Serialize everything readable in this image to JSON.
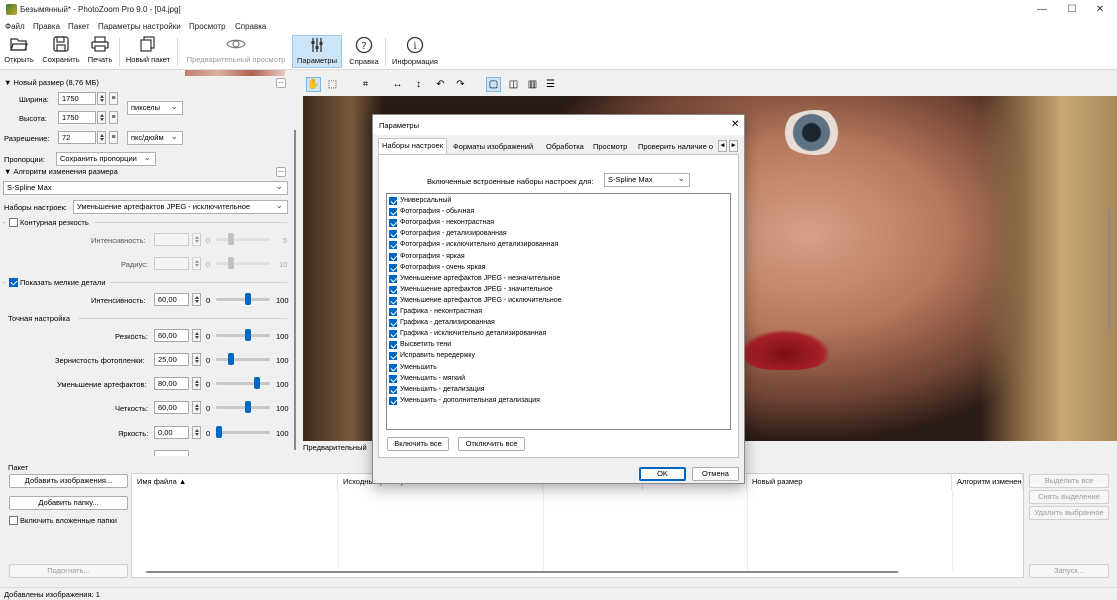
{
  "window": {
    "title": "Безымянный* - PhotoZoom Pro 9.0 - [04.jpg]",
    "minimize": "—",
    "maximize": "☐",
    "close": "✕"
  },
  "menu": [
    "Файл",
    "Правка",
    "Пакет",
    "Параметры настройки",
    "Просмотр",
    "Справка"
  ],
  "toolbar": {
    "open": "Открыть",
    "save": "Сохранить",
    "print": "Печать",
    "new_batch": "Новый пакет",
    "preview": "Предварительный просмотр",
    "params": "Параметры",
    "help": "Справка",
    "info": "Информация"
  },
  "left": {
    "new_size_header": "▼ Новый размер (8,76 МБ)",
    "width_label": "Ширина:",
    "width_value": "1750",
    "height_label": "Высота:",
    "height_value": "1750",
    "unit_pixels": "пикселы",
    "resolution_label": "Разрешение:",
    "resolution_value": "72",
    "resolution_unit": "пкс/дюйм",
    "proportions_label": "Пропорции:",
    "proportions_value": "Сохранить пропорции",
    "algorithm_header": "▼ Алгоритм изменения размера",
    "algorithm_value": "S-Spline Max",
    "presets_label": "Наборы настроек:",
    "presets_value": "Уменьшение артефактов JPEG - исключительное",
    "unsharp_label": "Контурная резкость",
    "unsharp_intensity_label": "Интенсивность:",
    "unsharp_intensity_min": "0",
    "unsharp_intensity_max": "5",
    "radius_label": "Радиус:",
    "radius_min": "0",
    "radius_max": "10",
    "show_details_label": "Показать мелкие детали",
    "details_intensity_label": "Интенсивность:",
    "details_intensity_value": "60,00",
    "fine_tune_label": "Точная настройка",
    "sharpness_label": "Резкость:",
    "sharpness_value": "60,00",
    "grain_label": "Зернистость фотопленки:",
    "grain_value": "25,00",
    "artifact_label": "Уменьшение артефактов:",
    "artifact_value": "80,00",
    "clarity_label": "Четкость:",
    "clarity_value": "60,00",
    "brightness_label": "Яркость:",
    "brightness_value": "0,00",
    "slider_min": "0",
    "slider_max": "100",
    "ellipsis": "..."
  },
  "sliders": {
    "details": 0.6,
    "sharpness": 0.6,
    "grain": 0.25,
    "artifact": 0.8,
    "clarity": 0.6,
    "brightness": 0.0
  },
  "preview_label": "Предварительный",
  "batch": {
    "header": "Пакет",
    "add_images": "Добавить изображения...",
    "add_folder": "Добавить папку...",
    "include_subfolders": "Включить вложенные папки",
    "fit": "Подогнать...",
    "columns": [
      "Имя файла ▲",
      "Исходный размер",
      "",
      "",
      "Новый размер",
      "Алгоритм изменения"
    ],
    "select_all": "Выделить все",
    "deselect": "Снять выделение",
    "delete_selected": "Удалить выбранное",
    "run": "Запуск..."
  },
  "status": "Добавлены изображения: 1",
  "dialog": {
    "title": "Параметры",
    "close": "✕",
    "tabs": [
      "Наборы настроек",
      "Форматы изображений",
      "Обработка",
      "Просмотр",
      "Проверить наличие о"
    ],
    "tab_prev": "◂",
    "tab_next": "▸",
    "builtin_label": "Включенные встроенные наборы настроек для:",
    "builtin_value": "S-Spline Max",
    "presets": [
      "Универсальный",
      "Фотография - обычная",
      "Фотография - неконтрастная",
      "Фотография - детализированная",
      "Фотография - исключительно детализированная",
      "Фотография - яркая",
      "Фотография - очень яркая",
      "Уменьшение артефактов JPEG - незначительное",
      "Уменьшение артефактов JPEG - значительное",
      "Уменьшение артефактов JPEG - исключительное",
      "Графика - неконтрастная",
      "Графика - детализированная",
      "Графика - исключительно детализированная",
      "Высветить тени",
      "Исправить передержку",
      "Уменьшить",
      "Уменьшить - мягкий",
      "Уменьшить - детализация",
      "Уменьшить - дополнительная детализация"
    ],
    "enable_all": "Включить все",
    "disable_all": "Отключить все",
    "ok": "OK",
    "cancel": "Отмена"
  }
}
